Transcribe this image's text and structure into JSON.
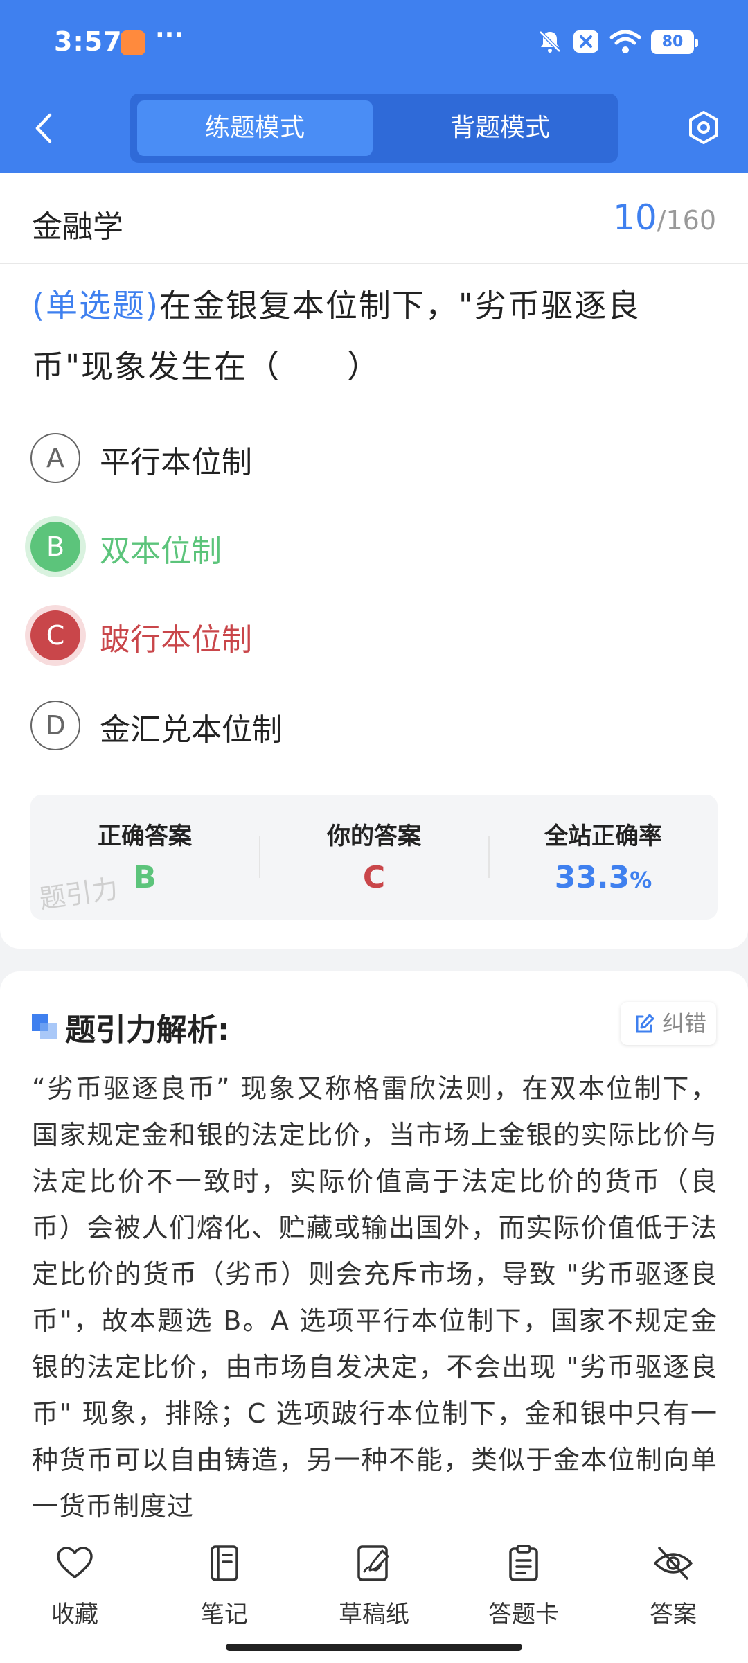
{
  "status_bar": {
    "time": "3:57",
    "more": "···",
    "battery": "80"
  },
  "nav": {
    "modes": [
      "练题模式",
      "背题模式"
    ],
    "active_mode": "练题模式"
  },
  "question": {
    "subject": "金融学",
    "current": "10",
    "separator": "/",
    "total": "160",
    "type": "(单选题)",
    "text": "在金银复本位制下，\"劣币驱逐良币\"现象发生在（　　）",
    "options": [
      {
        "letter": "A",
        "text": "平行本位制"
      },
      {
        "letter": "B",
        "text": "双本位制"
      },
      {
        "letter": "C",
        "text": "跛行本位制"
      },
      {
        "letter": "D",
        "text": "金汇兑本位制"
      }
    ]
  },
  "stats": {
    "correct_label": "正确答案",
    "correct_value": "B",
    "your_label": "你的答案",
    "your_value": "C",
    "rate_label": "全站正确率",
    "rate_value": "33.3",
    "rate_unit": "%",
    "watermark": "题引力"
  },
  "analysis": {
    "title": "题引力解析:",
    "report_label": "纠错",
    "body": "“劣币驱逐良币” 现象又称格雷欣法则，在双本位制下，国家规定金和银的法定比价，当市场上金银的实际比价与法定比价不一致时，实际价值高于法定比价的货币（良币）会被人们熔化、贮藏或输出国外，而实际价值低于法定比价的货币（劣币）则会充斥市场，导致 \"劣币驱逐良币\"，故本题选 B。A 选项平行本位制下，国家不规定金银的法定比价，由市场自发决定，不会出现 \"劣币驱逐良币\" 现象，排除；C 选项跛行本位制下，金和银中只有一种货币可以自由铸造，另一种不能，类似于金本位制向单一货币制度过"
  },
  "bottom_nav": {
    "items": [
      "收藏",
      "笔记",
      "草稿纸",
      "答题卡",
      "答案"
    ]
  },
  "colors": {
    "primary": "#3f80ef",
    "correct": "#5cc47b",
    "wrong": "#c9464a"
  }
}
